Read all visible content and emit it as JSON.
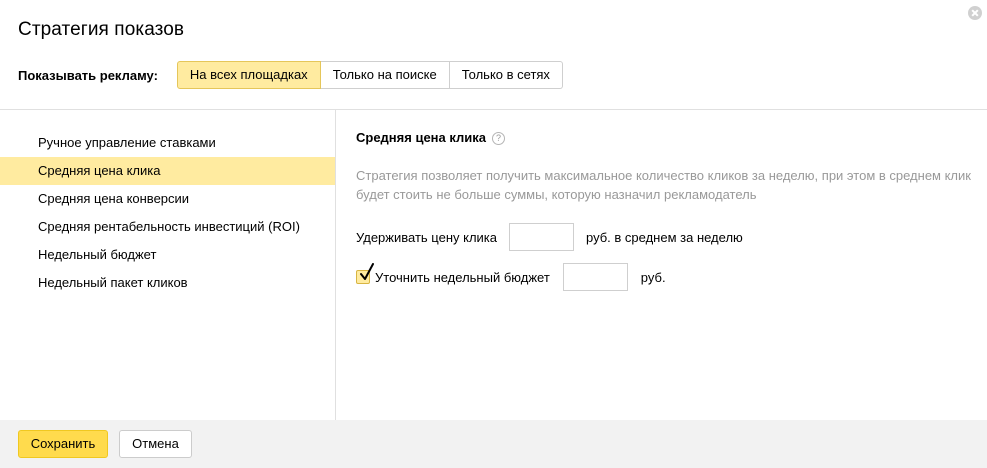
{
  "dialog": {
    "title": "Стратегия показов",
    "close_icon": "close-icon"
  },
  "show_ads": {
    "label": "Показывать рекламу:",
    "options": [
      {
        "label": "На всех площадках",
        "selected": true
      },
      {
        "label": "Только на поиске",
        "selected": false
      },
      {
        "label": "Только в сетях",
        "selected": false
      }
    ]
  },
  "strategies": {
    "items": [
      {
        "label": "Ручное управление ставками",
        "selected": false
      },
      {
        "label": "Средняя цена клика",
        "selected": true
      },
      {
        "label": "Средняя цена конверсии",
        "selected": false
      },
      {
        "label": "Средняя рентабельность инвестиций (ROI)",
        "selected": false
      },
      {
        "label": "Недельный бюджет",
        "selected": false
      },
      {
        "label": "Недельный пакет кликов",
        "selected": false
      }
    ]
  },
  "detail": {
    "title": "Средняя цена клика",
    "help_icon": "question-icon",
    "help_glyph": "?",
    "description": "Стратегия позволяет получить максимальное количество кликов за неделю, при этом в среднем клик будет стоить не больше суммы, которую назначил рекламодатель",
    "avg_price": {
      "label": "Удерживать цену клика",
      "value": "",
      "suffix": "руб. в среднем за неделю"
    },
    "weekly_budget": {
      "checked": true,
      "label": "Уточнить недельный бюджет",
      "value": "",
      "suffix": "руб."
    }
  },
  "footer": {
    "save_label": "Сохранить",
    "cancel_label": "Отмена"
  },
  "colors": {
    "accent_yellow": "#ffdb4d",
    "selected_bg": "#ffeba0",
    "muted_text": "#999999",
    "footer_bg": "#f2f2f2"
  }
}
